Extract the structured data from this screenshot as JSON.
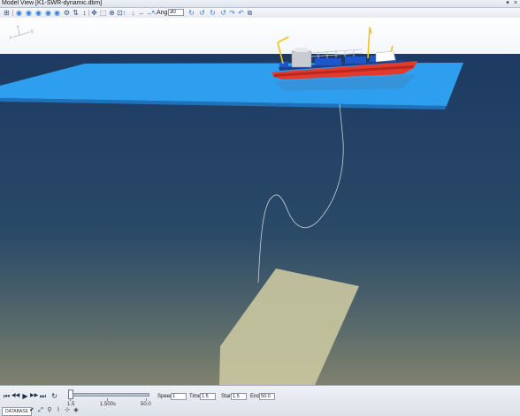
{
  "window": {
    "title": "Model View [K1-SWR-dynamic.dbm]",
    "pin_glyph": "▾",
    "pin_icon": "pin-icon",
    "close_glyph": "×",
    "close_icon": "close-icon"
  },
  "toolbar": {
    "buttons": [
      {
        "glyph": "⊞",
        "icon": "grid-icon"
      },
      {
        "glyph": "◉",
        "icon": "view-iso-icon"
      },
      {
        "glyph": "◉",
        "icon": "view-front-icon"
      },
      {
        "glyph": "◉",
        "icon": "view-side-icon"
      },
      {
        "glyph": "◉",
        "icon": "view-top-icon"
      },
      {
        "glyph": "◉",
        "icon": "view-bottom-icon"
      },
      {
        "glyph": "⚙",
        "icon": "vessel-icon"
      },
      {
        "glyph": "⇅",
        "icon": "elevation-icon"
      },
      {
        "glyph": "↕",
        "icon": "vertical-scale-icon"
      },
      {
        "glyph": "✥",
        "icon": "pan-icon"
      },
      {
        "glyph": "⬚",
        "icon": "fit-view-icon"
      },
      {
        "glyph": "⊕",
        "icon": "zoom-icon"
      },
      {
        "glyph": "⊡",
        "icon": "select-icon"
      },
      {
        "glyph": "↑",
        "icon": "arrow-up-icon"
      },
      {
        "glyph": "↓",
        "icon": "arrow-down-icon"
      },
      {
        "glyph": "←",
        "icon": "arrow-left-icon"
      },
      {
        "glyph": "→",
        "icon": "arrow-right-icon"
      },
      {
        "glyph": "↖",
        "icon": "arrow-up-left-icon"
      }
    ],
    "angle_label": "Angle",
    "angle_value": "30",
    "rotate_buttons": [
      {
        "glyph": "↻",
        "icon": "rotate-cw-icon"
      },
      {
        "glyph": "↺",
        "icon": "rotate-ccw-icon"
      },
      {
        "glyph": "↻",
        "icon": "roll-cw-icon"
      },
      {
        "glyph": "↺",
        "icon": "roll-ccw-icon"
      },
      {
        "glyph": "↷",
        "icon": "pitch-up-icon"
      },
      {
        "glyph": "↶",
        "icon": "pitch-down-icon"
      },
      {
        "glyph": "⧉",
        "icon": "copy-view-icon"
      }
    ]
  },
  "scene": {
    "sky_color": "#ffffff",
    "deep_water_color": "#1b3a63",
    "sea_surface_color": "#2ea0f0",
    "seabed_color": "#c8c6a0",
    "hull_color": "#e23b2e",
    "axes_labels": [
      "z",
      "y",
      "x"
    ]
  },
  "playback": {
    "buttons": [
      {
        "glyph": "⏮",
        "icon": "skip-to-start-icon"
      },
      {
        "glyph": "◀◀",
        "icon": "step-back-icon"
      },
      {
        "glyph": "▶",
        "icon": "play-icon"
      },
      {
        "glyph": "▶▶",
        "icon": "step-forward-icon"
      },
      {
        "glyph": "⏭",
        "icon": "skip-to-end-icon"
      },
      {
        "glyph": "↻",
        "icon": "loop-icon"
      }
    ],
    "slider_position_fraction": 0.0,
    "slider_labels": [
      "1.5",
      "1.500s",
      "50.0"
    ],
    "speed_label": "Speed",
    "speed_value": "1",
    "time_label": "Time",
    "time_value": "1.5",
    "start_label": "Start",
    "start_value": "1.5",
    "end_label": "End",
    "end_value": "50.0"
  },
  "bottom_toolbar": {
    "tab_label": "DATABASE",
    "icons": [
      {
        "glyph": "✔",
        "icon": "check-icon"
      },
      {
        "glyph": "⤢",
        "icon": "resize-icon"
      },
      {
        "glyph": "⚲",
        "icon": "marker-icon"
      },
      {
        "glyph": "⌇",
        "icon": "line-tool-icon"
      },
      {
        "glyph": "⊹",
        "icon": "node-tool-icon"
      },
      {
        "glyph": "◈",
        "icon": "render-icon"
      }
    ]
  }
}
